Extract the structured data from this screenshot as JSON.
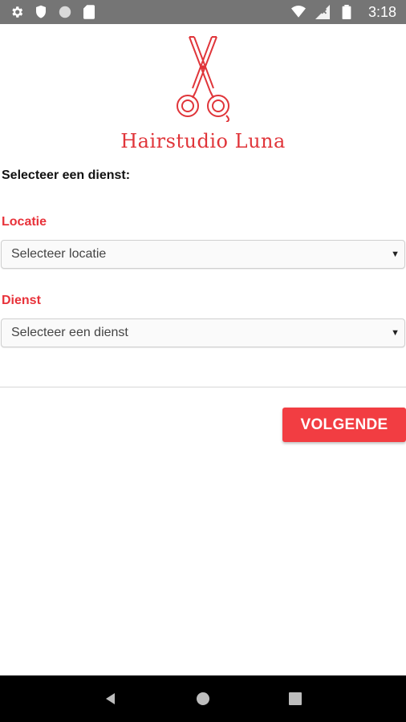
{
  "status_bar": {
    "time": "3:18",
    "icons_left": [
      "gear-icon",
      "shield-icon",
      "circle-icon",
      "sd-card-icon"
    ],
    "icons_right": [
      "wifi-icon",
      "signal-icon",
      "battery-icon"
    ]
  },
  "brand": {
    "name": "Hairstudio Luna",
    "color": "#e0353a",
    "logo_icon": "scissors-icon"
  },
  "form": {
    "prompt": "Selecteer een dienst:",
    "location_label": "Locatie",
    "location_placeholder": "Selecteer locatie",
    "service_label": "Dienst",
    "service_placeholder": "Selecteer een dienst",
    "label_color": "#e8323a"
  },
  "actions": {
    "next_label": "VOLGENDE",
    "next_color": "#f23d42"
  },
  "nav_bar": {
    "icons": [
      "back-icon",
      "home-icon",
      "recents-icon"
    ]
  }
}
